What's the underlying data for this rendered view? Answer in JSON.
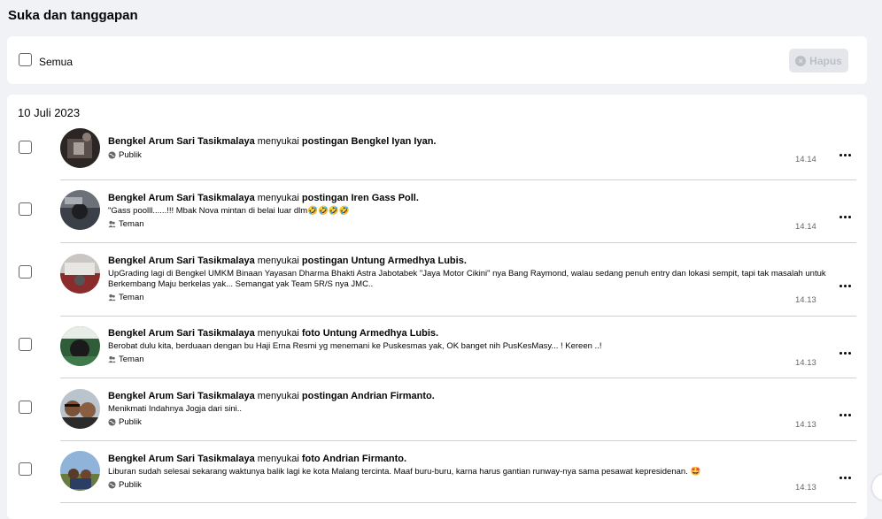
{
  "page": {
    "title": "Suka dan tanggapan"
  },
  "toolbar": {
    "select_all_label": "Semua",
    "delete_label": "Hapus"
  },
  "group": {
    "date": "10 Juli 2023"
  },
  "items": [
    {
      "actor": "Bengkel Arum Sari Tasikmalaya",
      "verb": " menyukai ",
      "object": "postingan Bengkel Iyan Iyan.",
      "snippet": "",
      "privacy": "Publik",
      "privacy_icon": "globe-icon",
      "time": "14.14"
    },
    {
      "actor": "Bengkel Arum Sari Tasikmalaya",
      "verb": " menyukai ",
      "object": "postingan Iren Gass Poll.",
      "snippet": "\"Gass poolll......!!! Mbak Nova mintan di belai luar dlm🤣🤣🤣🤣",
      "privacy": "Teman",
      "privacy_icon": "friends-icon",
      "time": "14.14"
    },
    {
      "actor": "Bengkel Arum Sari Tasikmalaya",
      "verb": " menyukai ",
      "object": "postingan Untung Armedhya Lubis.",
      "snippet": "UpGrading lagi di Bengkel UMKM Binaan Yayasan Dharma Bhakti Astra Jabotabek \"Jaya Motor Cikini\" nya Bang Raymond, walau sedang penuh entry dan lokasi sempit, tapi tak masalah untuk Berkembang Maju berkelas yak... Semangat yak Team 5R/S nya JMC..",
      "privacy": "Teman",
      "privacy_icon": "friends-icon",
      "time": "14.13"
    },
    {
      "actor": "Bengkel Arum Sari Tasikmalaya",
      "verb": " menyukai ",
      "object": "foto Untung Armedhya Lubis.",
      "snippet": "Berobat dulu kita, berduaan dengan bu Haji Erna Resmi yg menemani ke Puskesmas yak, OK banget nih PusKesMasy... ! Kereen ..!",
      "privacy": "Teman",
      "privacy_icon": "friends-icon",
      "time": "14.13"
    },
    {
      "actor": "Bengkel Arum Sari Tasikmalaya",
      "verb": " menyukai ",
      "object": "postingan Andrian Firmanto.",
      "snippet": "Menikmati Indahnya Jogja dari sini..",
      "privacy": "Publik",
      "privacy_icon": "globe-icon",
      "time": "14.13"
    },
    {
      "actor": "Bengkel Arum Sari Tasikmalaya",
      "verb": " menyukai ",
      "object": "foto Andrian Firmanto.",
      "snippet": "Liburan sudah selesai sekarang waktunya balik lagi ke kota Malang tercinta. Maaf buru-buru, karna harus gantian runway-nya sama pesawat kepresidenan. 🤩",
      "privacy": "Publik",
      "privacy_icon": "globe-icon",
      "time": "14.13"
    }
  ]
}
